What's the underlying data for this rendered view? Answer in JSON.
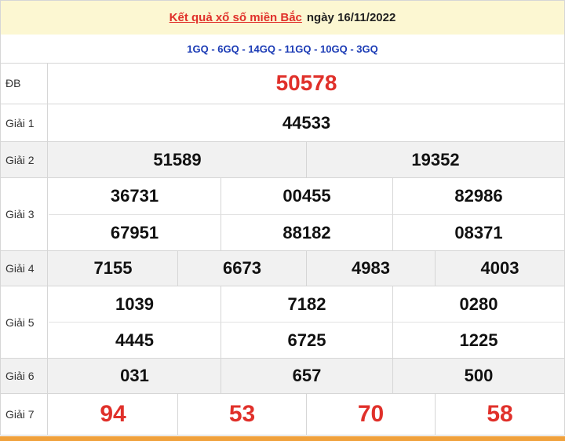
{
  "header": {
    "link_text": "Kết quả xổ số miền Bắc",
    "date_text": "ngày 16/11/2022"
  },
  "codes": "1GQ - 6GQ - 14GQ - 11GQ - 10GQ - 3GQ",
  "labels": {
    "db": "ĐB",
    "g1": "Giải 1",
    "g2": "Giải 2",
    "g3": "Giải 3",
    "g4": "Giải 4",
    "g5": "Giải 5",
    "g6": "Giải 6",
    "g7": "Giải 7"
  },
  "results": {
    "db": "50578",
    "g1": "44533",
    "g2": [
      "51589",
      "19352"
    ],
    "g3": [
      "36731",
      "00455",
      "82986",
      "67951",
      "88182",
      "08371"
    ],
    "g4": [
      "7155",
      "6673",
      "4983",
      "4003"
    ],
    "g5": [
      "1039",
      "7182",
      "0280",
      "4445",
      "6725",
      "1225"
    ],
    "g6": [
      "031",
      "657",
      "500"
    ],
    "g7": [
      "94",
      "53",
      "70",
      "58"
    ]
  }
}
